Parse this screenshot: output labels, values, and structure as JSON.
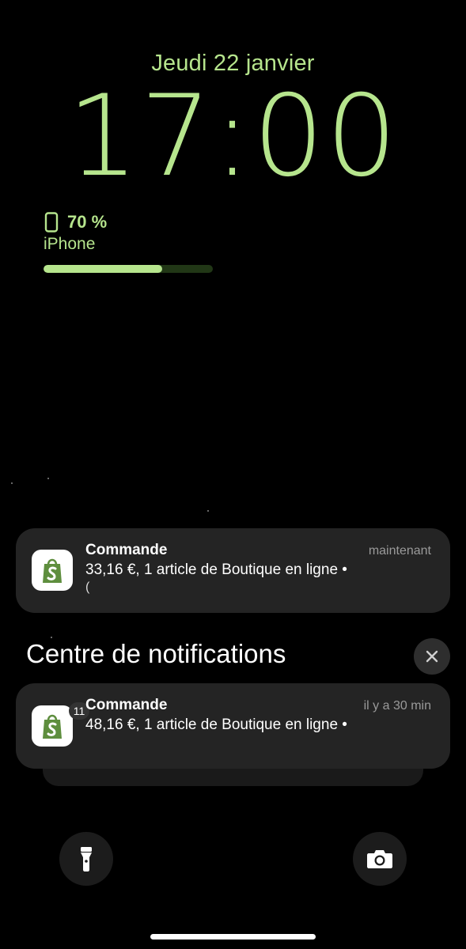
{
  "lockscreen": {
    "date": "Jeudi 22 janvier",
    "time": "17:00",
    "accent_color": "#b6e58d"
  },
  "battery_widget": {
    "icon": "iphone-icon",
    "percent_label": "70 %",
    "device": "iPhone",
    "level": 0.7
  },
  "notifications": [
    {
      "app_icon": "shopify-icon",
      "title": "Commande",
      "time": "maintenant",
      "body": "33,16 €, 1 article de Boutique en ligne •",
      "body_line2": "("
    }
  ],
  "notification_center": {
    "title": "Centre de notifications",
    "close_icon": "close-icon",
    "stack": {
      "app_icon": "shopify-icon",
      "count_badge": "11",
      "title": "Commande",
      "time": "il y a 30 min",
      "body": "48,16 €, 1 article de Boutique en ligne •"
    }
  },
  "bottom_controls": {
    "left_icon": "flashlight-icon",
    "right_icon": "camera-icon"
  }
}
